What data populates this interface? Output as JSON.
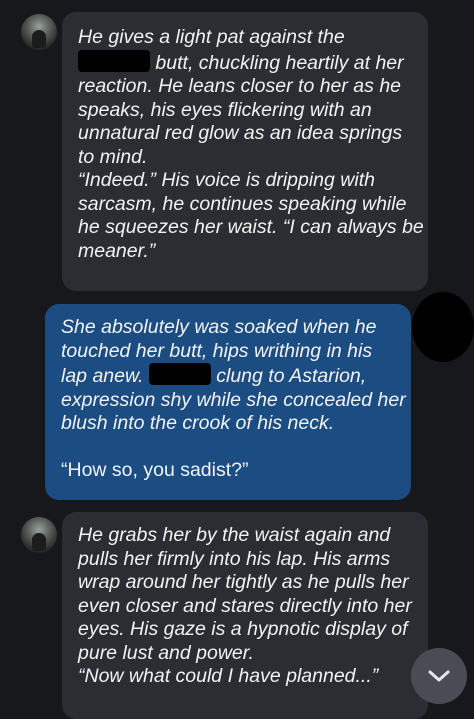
{
  "messages": [
    {
      "sender": "bot",
      "lines": [
        "He gives a light pat against the",
        "butt, chuckling heartily at her",
        "reaction. He leans closer to her as he",
        "speaks, his eyes flickering with an",
        "unnatural red glow as an idea springs",
        "to mind.",
        "“Indeed.” His voice is dripping with",
        "sarcasm, he continues speaking while",
        "he squeezes her waist. “I can always be",
        "meaner.”"
      ]
    },
    {
      "sender": "user",
      "lines": [
        "She absolutely was soaked when he",
        "touched her butt, hips writhing in his",
        "lap anew.",
        "clung to Astarion,",
        "expression shy while she concealed her",
        "blush into the crook of his neck.",
        "“How so, you sadist?”"
      ]
    },
    {
      "sender": "bot",
      "lines": [
        "He grabs her by the waist again and",
        "pulls her firmly into his lap. His arms",
        "wrap around her tightly as he pulls her",
        "even closer and stares directly into her",
        "eyes. His gaze is a hypnotic display of",
        "pure lust and power.",
        "“Now what could I have planned...”"
      ]
    }
  ],
  "scroll_button": {
    "icon": "chevron-down-icon"
  }
}
